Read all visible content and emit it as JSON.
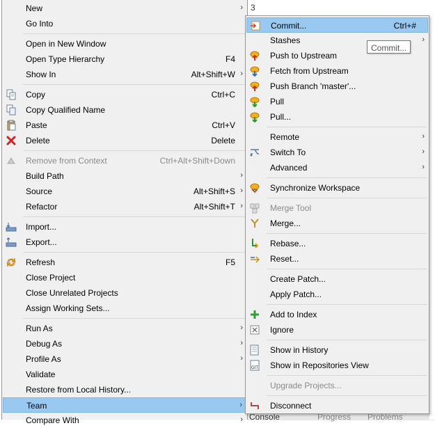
{
  "background": {
    "editor_fragment": "3",
    "bottom_tabs": [
      "Console",
      "Progress",
      "Problems"
    ]
  },
  "main_menu": {
    "new": {
      "label": "New"
    },
    "go_into": {
      "label": "Go Into"
    },
    "open_new_window": {
      "label": "Open in New Window"
    },
    "open_type_hierarchy": {
      "label": "Open Type Hierarchy",
      "shortcut": "F4"
    },
    "show_in": {
      "label": "Show In",
      "shortcut": "Alt+Shift+W"
    },
    "copy": {
      "label": "Copy",
      "shortcut": "Ctrl+C"
    },
    "copy_qualified": {
      "label": "Copy Qualified Name"
    },
    "paste": {
      "label": "Paste",
      "shortcut": "Ctrl+V"
    },
    "delete": {
      "label": "Delete",
      "shortcut": "Delete"
    },
    "remove_context": {
      "label": "Remove from Context",
      "shortcut": "Ctrl+Alt+Shift+Down"
    },
    "build_path": {
      "label": "Build Path"
    },
    "source": {
      "label": "Source",
      "shortcut": "Alt+Shift+S"
    },
    "refactor": {
      "label": "Refactor",
      "shortcut": "Alt+Shift+T"
    },
    "import": {
      "label": "Import..."
    },
    "export": {
      "label": "Export..."
    },
    "refresh": {
      "label": "Refresh",
      "shortcut": "F5"
    },
    "close_project": {
      "label": "Close Project"
    },
    "close_unrelated": {
      "label": "Close Unrelated Projects"
    },
    "assign_working_sets": {
      "label": "Assign Working Sets..."
    },
    "run_as": {
      "label": "Run As"
    },
    "debug_as": {
      "label": "Debug As"
    },
    "profile_as": {
      "label": "Profile As"
    },
    "validate": {
      "label": "Validate"
    },
    "restore_history": {
      "label": "Restore from Local History..."
    },
    "team": {
      "label": "Team"
    },
    "compare_with": {
      "label": "Compare With"
    }
  },
  "team_menu": {
    "commit": {
      "label": "Commit...",
      "shortcut": "Ctrl+#"
    },
    "stashes": {
      "label": "Stashes"
    },
    "push_upstream": {
      "label": "Push to Upstream"
    },
    "fetch_upstream": {
      "label": "Fetch from Upstream"
    },
    "push_branch": {
      "label": "Push Branch 'master'..."
    },
    "pull": {
      "label": "Pull"
    },
    "pull_dialog": {
      "label": "Pull..."
    },
    "remote": {
      "label": "Remote"
    },
    "switch_to": {
      "label": "Switch To"
    },
    "advanced": {
      "label": "Advanced"
    },
    "synchronize": {
      "label": "Synchronize Workspace"
    },
    "merge_tool": {
      "label": "Merge Tool"
    },
    "merge": {
      "label": "Merge..."
    },
    "rebase": {
      "label": "Rebase..."
    },
    "reset": {
      "label": "Reset..."
    },
    "create_patch": {
      "label": "Create Patch..."
    },
    "apply_patch": {
      "label": "Apply Patch..."
    },
    "add_to_index": {
      "label": "Add to Index"
    },
    "ignore": {
      "label": "Ignore"
    },
    "show_history": {
      "label": "Show in History"
    },
    "show_repos_view": {
      "label": "Show in Repositories View"
    },
    "upgrade_projects": {
      "label": "Upgrade Projects..."
    },
    "disconnect": {
      "label": "Disconnect"
    }
  },
  "tooltip": {
    "text": "Commit..."
  },
  "colors": {
    "menu_bg": "#f0f0f0",
    "selection": "#99c9f1",
    "disabled_text": "#8a8a8a",
    "separator": "#d7d7d7"
  }
}
